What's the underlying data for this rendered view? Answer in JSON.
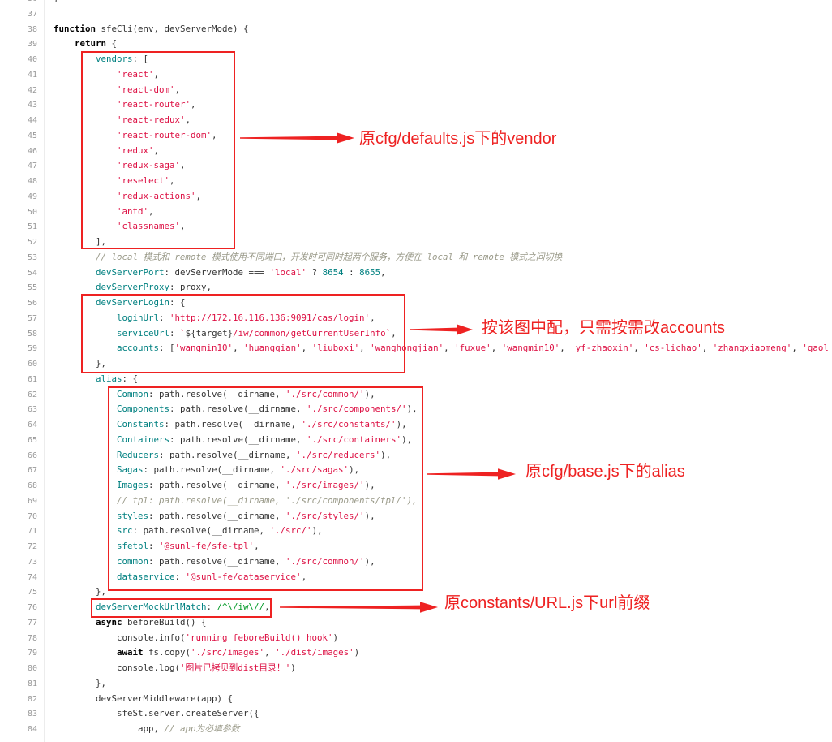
{
  "colors": {
    "keyword": "#000000",
    "attribute": "#008080",
    "string": "#dd1144",
    "number": "#008080",
    "comment": "#999988",
    "regexp": "#009926",
    "plain": "#333333",
    "line_number": "#999999",
    "annotation": "#ee2222"
  },
  "code": {
    "lines": [
      {
        "n": "36",
        "t": [
          "}"
        ]
      },
      {
        "n": "37",
        "t": []
      },
      {
        "n": "38",
        "t": [
          [
            "function",
            "#000000"
          ],
          " sfeCli(env, devServerMode) {"
        ]
      },
      {
        "n": "39",
        "t": [
          "    ",
          [
            "return",
            "#000000"
          ],
          " {"
        ]
      },
      {
        "n": "40",
        "t": [
          "        ",
          [
            "vendors",
            "#008080"
          ],
          ": ["
        ]
      },
      {
        "n": "41",
        "t": [
          "            ",
          [
            "'react'",
            "#dd1144"
          ],
          ","
        ]
      },
      {
        "n": "42",
        "t": [
          "            ",
          [
            "'react-dom'",
            "#dd1144"
          ],
          ","
        ]
      },
      {
        "n": "43",
        "t": [
          "            ",
          [
            "'react-router'",
            "#dd1144"
          ],
          ","
        ]
      },
      {
        "n": "44",
        "t": [
          "            ",
          [
            "'react-redux'",
            "#dd1144"
          ],
          ","
        ]
      },
      {
        "n": "45",
        "t": [
          "            ",
          [
            "'react-router-dom'",
            "#dd1144"
          ],
          ","
        ]
      },
      {
        "n": "46",
        "t": [
          "            ",
          [
            "'redux'",
            "#dd1144"
          ],
          ","
        ]
      },
      {
        "n": "47",
        "t": [
          "            ",
          [
            "'redux-saga'",
            "#dd1144"
          ],
          ","
        ]
      },
      {
        "n": "48",
        "t": [
          "            ",
          [
            "'reselect'",
            "#dd1144"
          ],
          ","
        ]
      },
      {
        "n": "49",
        "t": [
          "            ",
          [
            "'redux-actions'",
            "#dd1144"
          ],
          ","
        ]
      },
      {
        "n": "50",
        "t": [
          "            ",
          [
            "'antd'",
            "#dd1144"
          ],
          ","
        ]
      },
      {
        "n": "51",
        "t": [
          "            ",
          [
            "'classnames'",
            "#dd1144"
          ],
          ","
        ]
      },
      {
        "n": "52",
        "t": [
          "        ],"
        ]
      },
      {
        "n": "53",
        "t": [
          "        ",
          [
            "// local 模式和 remote 模式使用不同端口，开发时可同时起两个服务，方便在 local 和 remote 模式之间切换",
            "#999988"
          ]
        ]
      },
      {
        "n": "54",
        "t": [
          "        ",
          [
            "devServerPort",
            "#008080"
          ],
          ": devServerMode === ",
          [
            "'local'",
            "#dd1144"
          ],
          " ? ",
          [
            "8654",
            "#008080"
          ],
          " : ",
          [
            "8655",
            "#008080"
          ],
          ","
        ]
      },
      {
        "n": "55",
        "t": [
          "        ",
          [
            "devServerProxy",
            "#008080"
          ],
          ": proxy,"
        ]
      },
      {
        "n": "56",
        "t": [
          "        ",
          [
            "devServerLogin",
            "#008080"
          ],
          ": {"
        ]
      },
      {
        "n": "57",
        "t": [
          "            ",
          [
            "loginUrl",
            "#008080"
          ],
          ": ",
          [
            "'http://172.16.116.136:9091/cas/login'",
            "#dd1144"
          ],
          ","
        ]
      },
      {
        "n": "58",
        "t": [
          "            ",
          [
            "serviceUrl",
            "#008080"
          ],
          ": ",
          [
            "`",
            "#dd1144"
          ],
          "${target}",
          [
            "/iw/common/getCurrentUserInfo`",
            "#dd1144"
          ],
          ","
        ]
      },
      {
        "n": "59",
        "t": [
          "            ",
          [
            "accounts",
            "#008080"
          ],
          ": [",
          [
            "'wangmin10'",
            "#dd1144"
          ],
          ", ",
          [
            "'huangqian'",
            "#dd1144"
          ],
          ", ",
          [
            "'liuboxi'",
            "#dd1144"
          ],
          ", ",
          [
            "'wanghongjian'",
            "#dd1144"
          ],
          ", ",
          [
            "'fuxue'",
            "#dd1144"
          ],
          ", ",
          [
            "'wangmin10'",
            "#dd1144"
          ],
          ", ",
          [
            "'yf-zhaoxin'",
            "#dd1144"
          ],
          ", ",
          [
            "'cs-lichao'",
            "#dd1144"
          ],
          ", ",
          [
            "'zhangxiaomeng'",
            "#dd1144"
          ],
          ", ",
          [
            "'gaol",
            "#dd1144"
          ]
        ]
      },
      {
        "n": "60",
        "t": [
          "        },"
        ]
      },
      {
        "n": "61",
        "t": [
          "        ",
          [
            "alias",
            "#008080"
          ],
          ": {"
        ]
      },
      {
        "n": "62",
        "t": [
          "            ",
          [
            "Common",
            "#008080"
          ],
          ": path.resolve(__dirname, ",
          [
            "'./src/common/'",
            "#dd1144"
          ],
          "),"
        ]
      },
      {
        "n": "63",
        "t": [
          "            ",
          [
            "Components",
            "#008080"
          ],
          ": path.resolve(__dirname, ",
          [
            "'./src/components/'",
            "#dd1144"
          ],
          "),"
        ]
      },
      {
        "n": "64",
        "t": [
          "            ",
          [
            "Constants",
            "#008080"
          ],
          ": path.resolve(__dirname, ",
          [
            "'./src/constants/'",
            "#dd1144"
          ],
          "),"
        ]
      },
      {
        "n": "65",
        "t": [
          "            ",
          [
            "Containers",
            "#008080"
          ],
          ": path.resolve(__dirname, ",
          [
            "'./src/containers'",
            "#dd1144"
          ],
          "),"
        ]
      },
      {
        "n": "66",
        "t": [
          "            ",
          [
            "Reducers",
            "#008080"
          ],
          ": path.resolve(__dirname, ",
          [
            "'./src/reducers'",
            "#dd1144"
          ],
          "),"
        ]
      },
      {
        "n": "67",
        "t": [
          "            ",
          [
            "Sagas",
            "#008080"
          ],
          ": path.resolve(__dirname, ",
          [
            "'./src/sagas'",
            "#dd1144"
          ],
          "),"
        ]
      },
      {
        "n": "68",
        "t": [
          "            ",
          [
            "Images",
            "#008080"
          ],
          ": path.resolve(__dirname, ",
          [
            "'./src/images/'",
            "#dd1144"
          ],
          "),"
        ]
      },
      {
        "n": "69",
        "t": [
          "            ",
          [
            "// tpl: path.resolve(__dirname, './src/components/tpl/'),",
            "#999988"
          ]
        ]
      },
      {
        "n": "70",
        "t": [
          "            ",
          [
            "styles",
            "#008080"
          ],
          ": path.resolve(__dirname, ",
          [
            "'./src/styles/'",
            "#dd1144"
          ],
          "),"
        ]
      },
      {
        "n": "71",
        "t": [
          "            ",
          [
            "src",
            "#008080"
          ],
          ": path.resolve(__dirname, ",
          [
            "'./src/'",
            "#dd1144"
          ],
          "),"
        ]
      },
      {
        "n": "72",
        "t": [
          "            ",
          [
            "sfetpl",
            "#008080"
          ],
          ": ",
          [
            "'@sunl-fe/sfe-tpl'",
            "#dd1144"
          ],
          ","
        ]
      },
      {
        "n": "73",
        "t": [
          "            ",
          [
            "common",
            "#008080"
          ],
          ": path.resolve(__dirname, ",
          [
            "'./src/common/'",
            "#dd1144"
          ],
          "),"
        ]
      },
      {
        "n": "74",
        "t": [
          "            ",
          [
            "dataservice",
            "#008080"
          ],
          ": ",
          [
            "'@sunl-fe/dataservice'",
            "#dd1144"
          ],
          ","
        ]
      },
      {
        "n": "75",
        "t": [
          "        },"
        ]
      },
      {
        "n": "76",
        "t": [
          "        ",
          [
            "devServerMockUrlMatch",
            "#008080"
          ],
          ": ",
          [
            "/^\\/iw\\//",
            "#009926"
          ],
          ","
        ]
      },
      {
        "n": "77",
        "t": [
          "        ",
          [
            "async",
            "#000000"
          ],
          " beforeBuild() {"
        ]
      },
      {
        "n": "78",
        "t": [
          "            console.info(",
          [
            "'running feboreBuild() hook'",
            "#dd1144"
          ],
          ")"
        ]
      },
      {
        "n": "79",
        "t": [
          "            ",
          [
            "await",
            "#000000"
          ],
          " fs.copy(",
          [
            "'./src/images'",
            "#dd1144"
          ],
          ", ",
          [
            "'./dist/images'",
            "#dd1144"
          ],
          ")"
        ]
      },
      {
        "n": "80",
        "t": [
          "            console.log(",
          [
            "'图片已拷贝到dist目录！'",
            "#dd1144"
          ],
          ")"
        ]
      },
      {
        "n": "81",
        "t": [
          "        },"
        ]
      },
      {
        "n": "82",
        "t": [
          "        devServerMiddleware(app) {"
        ]
      },
      {
        "n": "83",
        "t": [
          "            sfeSt.server.createServer({"
        ]
      },
      {
        "n": "84",
        "t": [
          "                app, ",
          [
            "// app为必填参数",
            "#999988"
          ]
        ]
      }
    ]
  },
  "annotations": [
    {
      "label": "原cfg/defaults.js下的vendor"
    },
    {
      "label": "按该图中配，只需按需改accounts"
    },
    {
      "label": "原cfg/base.js下的alias"
    },
    {
      "label": "原constants/URL.js下url前缀"
    }
  ]
}
